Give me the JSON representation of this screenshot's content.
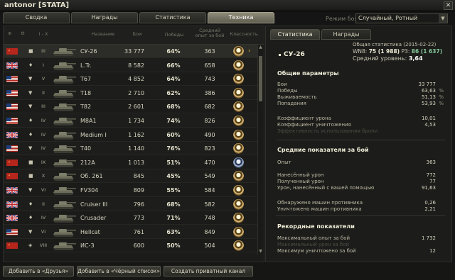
{
  "window": {
    "title": "antonor [STATA]"
  },
  "tabs": [
    "Сводка",
    "Награды",
    "Статистика",
    "Техника"
  ],
  "mode": {
    "label": "Режим боя:",
    "value": "Случайный, Ротный"
  },
  "table": {
    "headers": {
      "tier": "I - X",
      "name": "Название",
      "battles": "Бои",
      "wins": "Победы",
      "avgxp": "Средний опыт за бой",
      "mastery": "Классность"
    },
    "rows": [
      {
        "nation": "ussr",
        "type": "■",
        "tier": "III",
        "name": "СУ-26",
        "battles": "33 777",
        "wins": "64%",
        "avgxp": "363",
        "badge": "gold",
        "selected": true
      },
      {
        "nation": "uk",
        "type": "♦",
        "tier": "I",
        "name": "L.Tr.",
        "battles": "8 582",
        "wins": "66%",
        "avgxp": "658",
        "badge": "gold"
      },
      {
        "nation": "usa",
        "type": "▼",
        "tier": "V",
        "name": "T67",
        "battles": "4 852",
        "wins": "64%",
        "avgxp": "743",
        "badge": "gold"
      },
      {
        "nation": "usa",
        "type": "▼",
        "tier": "II",
        "name": "T18",
        "battles": "2 710",
        "wins": "62%",
        "avgxp": "386",
        "badge": "gold"
      },
      {
        "nation": "usa",
        "type": "▼",
        "tier": "III",
        "name": "T82",
        "battles": "2 601",
        "wins": "68%",
        "avgxp": "682",
        "badge": "gold"
      },
      {
        "nation": "usa",
        "type": "♦",
        "tier": "IV",
        "name": "M8A1",
        "battles": "1 734",
        "wins": "74%",
        "avgxp": "826",
        "badge": "gold"
      },
      {
        "nation": "uk",
        "type": "♦",
        "tier": "IV",
        "name": "Medium I",
        "battles": "1 162",
        "wins": "60%",
        "avgxp": "490",
        "badge": "gold"
      },
      {
        "nation": "usa",
        "type": "▼",
        "tier": "IV",
        "name": "T40",
        "battles": "1 140",
        "wins": "76%",
        "avgxp": "823",
        "badge": "gold"
      },
      {
        "nation": "ussr",
        "type": "■",
        "tier": "IX",
        "name": "212A",
        "battles": "1 013",
        "wins": "51%",
        "avgxp": "470",
        "badge": "blue"
      },
      {
        "nation": "ussr",
        "type": "■",
        "tier": "X",
        "name": "Об. 261",
        "battles": "845",
        "wins": "45%",
        "avgxp": "549",
        "badge": "gold"
      },
      {
        "nation": "uk",
        "type": "▼",
        "tier": "VI",
        "name": "FV304",
        "battles": "809",
        "wins": "55%",
        "avgxp": "584",
        "badge": "gold"
      },
      {
        "nation": "uk",
        "type": "♦",
        "tier": "II",
        "name": "Cruiser III",
        "battles": "796",
        "wins": "68%",
        "avgxp": "582",
        "badge": "gold"
      },
      {
        "nation": "uk",
        "type": "♦",
        "tier": "IV",
        "name": "Crusader",
        "battles": "773",
        "wins": "71%",
        "avgxp": "748",
        "badge": "gold"
      },
      {
        "nation": "usa",
        "type": "▼",
        "tier": "VI",
        "name": "Hellcat",
        "battles": "761",
        "wins": "63%",
        "avgxp": "849",
        "badge": "gold"
      },
      {
        "nation": "ussr",
        "type": "◈",
        "tier": "VIII",
        "name": "ИС-3",
        "battles": "600",
        "wins": "50%",
        "avgxp": "504",
        "badge": "gold"
      }
    ]
  },
  "panel": {
    "tabs": [
      "Статистика",
      "Награды"
    ],
    "vehicle": "СУ-26",
    "overall": "Общая статистика (2015-02-22)",
    "wn8_label": "WN8:",
    "wn8_value": "75 (1 988)",
    "rz_label": "РЗ:",
    "rz_value": "86 (1 637)",
    "avg_tier_label": "Средний уровень:",
    "avg_tier": "3,64",
    "general": {
      "title": "Общие параметры",
      "rows": [
        {
          "label": "Бои",
          "value": "33 777",
          "unit": ""
        },
        {
          "label": "Победы",
          "value": "63,63",
          "unit": "%"
        },
        {
          "label": "Выживаемость",
          "value": "51,13",
          "unit": "%"
        },
        {
          "label": "Попадания",
          "value": "53,93",
          "unit": "%"
        },
        {
          "label": "Коэффициент урона",
          "value": "10,01",
          "unit": ""
        },
        {
          "label": "Коэффициент уничтожения",
          "value": "4,53",
          "unit": ""
        },
        {
          "label": "Эффективность использования брони",
          "value": "",
          "unit": ""
        }
      ]
    },
    "average": {
      "title": "Средние показатели за бой",
      "rows": [
        {
          "label": "Опыт",
          "value": "363"
        },
        {
          "label": "Нанесённый урон",
          "value": "772"
        },
        {
          "label": "Полученный урон",
          "value": "77"
        },
        {
          "label": "Урон, нанесённый с вашей помощью",
          "value": "91,63"
        },
        {
          "label": "Обнаружено машин противника",
          "value": "0,26"
        },
        {
          "label": "Уничтожено машин противника",
          "value": "2,21"
        }
      ]
    },
    "records": {
      "title": "Рекордные показатели",
      "rows": [
        {
          "label": "Максимальный опыт за бой",
          "value": "1 732"
        },
        {
          "label": "Максимальный урон за бой",
          "value": ""
        },
        {
          "label": "Максимум уничтожено за бой",
          "value": "12"
        }
      ]
    }
  },
  "buttons": [
    "Добавить в «Друзья»",
    "Добавить в «Чёрный список»",
    "Создать приватный канал"
  ],
  "colors": {
    "win_highlight": "#e5e1cc",
    "accent_gold": "#d6a42d",
    "wn8_green": "#86c79a"
  }
}
